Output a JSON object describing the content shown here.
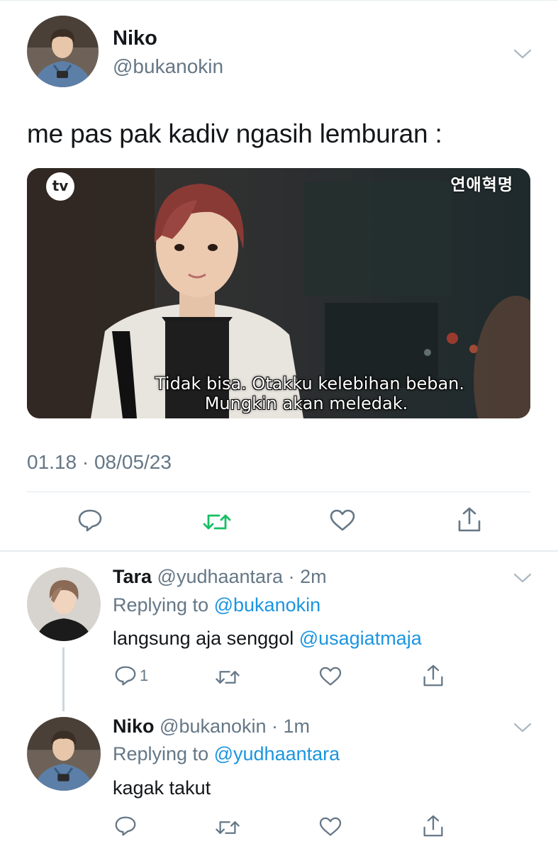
{
  "tweet": {
    "name": "Niko",
    "handle": "@bukanokin",
    "text": "me pas pak kadiv ngasih lemburan :",
    "media": {
      "logo": "tv",
      "brand": "연애혁명",
      "subtitle_line1": "Tidak bisa. Otakku kelebihan beban.",
      "subtitle_line2": "Mungkin akan meledak."
    },
    "timestamp": "01.18 · 08/05/23",
    "actions": [
      "reply-icon",
      "retweet-icon",
      "like-icon",
      "share-icon"
    ],
    "retweet_color": "#17bf63"
  },
  "replies": [
    {
      "name": "Tara",
      "meta": "@yudhaantara · 2m",
      "replying_label": "Replying to",
      "replying_to": "@bukanokin",
      "text_prefix": "langsung aja senggol ",
      "text_mention": "@usagiatmaja",
      "reply_count": "1"
    },
    {
      "name": "Niko",
      "meta": "@bukanokin · 1m",
      "replying_label": "Replying to",
      "replying_to": "@yudhaantara",
      "text": "kagak takut"
    }
  ],
  "colors": {
    "text": "#14171a",
    "secondary": "#657786",
    "link": "#1b95e0",
    "divider": "#e1e8ed"
  }
}
